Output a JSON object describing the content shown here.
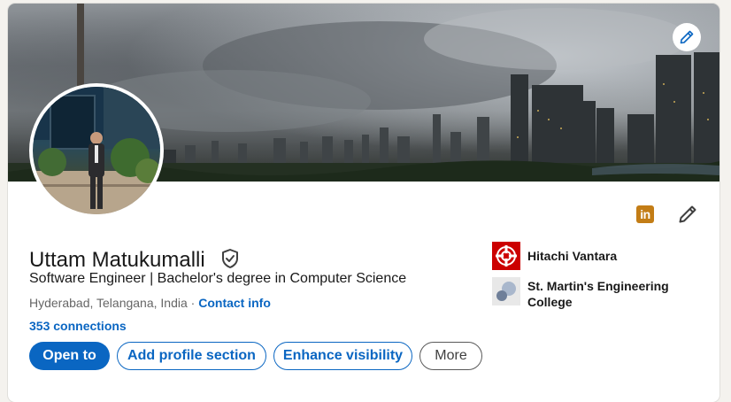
{
  "profile": {
    "name": "Uttam Matukumalli",
    "headline": "Software Engineer | Bachelor's degree in Computer Science",
    "location": "Hyderabad, Telangana, India",
    "separator": "·",
    "contact_info": "Contact info",
    "connections": "353 connections"
  },
  "actions": {
    "open_to": "Open to",
    "add_section": "Add profile section",
    "enhance_visibility": "Enhance visibility",
    "more": "More"
  },
  "experience": [
    {
      "name": "Hitachi Vantara",
      "logo": "hitachi-logo",
      "color": "#cc0000"
    },
    {
      "name": "St. Martin's Engineering College",
      "logo": "college-logo",
      "color": "#e8e8e8"
    }
  ],
  "icons": {
    "cover_edit": "pencil-icon",
    "linkedin_badge": "in",
    "profile_edit": "pencil-icon",
    "verified": "shield-check-icon"
  },
  "colors": {
    "accent": "#0a66c2",
    "linkedin_badge": "#c37d16",
    "text": "#191919",
    "muted": "#666666"
  }
}
